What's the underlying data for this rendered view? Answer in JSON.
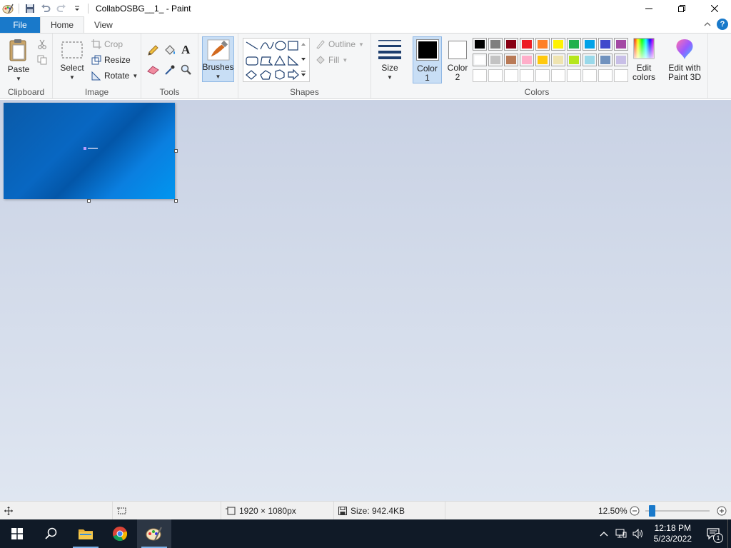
{
  "window": {
    "title": "CollabOSBG__1_ - Paint"
  },
  "tabs": {
    "file": "File",
    "home": "Home",
    "view": "View"
  },
  "clipboard": {
    "label": "Clipboard",
    "paste": "Paste"
  },
  "image_group": {
    "label": "Image",
    "select": "Select",
    "crop": "Crop",
    "resize": "Resize",
    "rotate": "Rotate"
  },
  "tools": {
    "label": "Tools"
  },
  "brushes": {
    "label": "Brushes"
  },
  "shapes": {
    "label": "Shapes",
    "outline": "Outline",
    "fill": "Fill"
  },
  "size": {
    "label": "Size"
  },
  "colors": {
    "label": "Colors",
    "color1_line1": "Color",
    "color1_line2": "1",
    "color2_line1": "Color",
    "color2_line2": "2",
    "edit_colors_line1": "Edit",
    "edit_colors_line2": "colors",
    "paint3d_line1": "Edit with",
    "paint3d_line2": "Paint 3D",
    "color1_value": "#000000",
    "color2_value": "#ffffff",
    "palette_row1": [
      "#000000",
      "#7f7f7f",
      "#880015",
      "#ed1c24",
      "#ff7f27",
      "#fff200",
      "#22b14c",
      "#00a2e8",
      "#3f48cc",
      "#a349a4"
    ],
    "palette_row2": [
      "#ffffff",
      "#c3c3c3",
      "#b97a57",
      "#ffaec9",
      "#ffc90e",
      "#efe4b0",
      "#b5e61d",
      "#99d9ea",
      "#7092be",
      "#c8bfe7"
    ]
  },
  "status": {
    "dimensions": "1920 × 1080px",
    "size": "Size: 942.4KB",
    "zoom": "12.50%",
    "zoom_level": 0.0156
  },
  "taskbar": {
    "time": "12:18 PM",
    "date": "5/23/2022",
    "notifications": "1"
  }
}
